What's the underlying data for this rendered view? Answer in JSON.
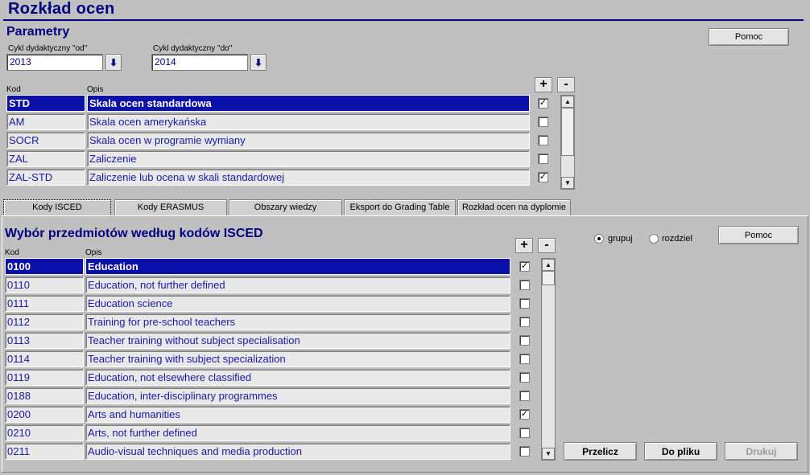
{
  "window": {
    "title": "Rozkład  ocen"
  },
  "params": {
    "section_title": "Parametry",
    "from_label": "Cykl dydaktyczny \"od\"",
    "from_value": "2013",
    "to_label": "Cykl dydaktyczny \"do\"",
    "to_value": "2014",
    "help_label": "Pomoc",
    "col_code": "Kod",
    "col_desc": "Opis",
    "plus": "+",
    "minus": "-",
    "rows": [
      {
        "code": "STD",
        "desc": "Skala ocen standardowa",
        "checked": true,
        "selected": true
      },
      {
        "code": "AM",
        "desc": "Skala ocen amerykańska",
        "checked": false,
        "selected": false
      },
      {
        "code": "SOCR",
        "desc": "Skala ocen w programie wymiany",
        "checked": false,
        "selected": false
      },
      {
        "code": "ZAL",
        "desc": "Zaliczenie",
        "checked": false,
        "selected": false
      },
      {
        "code": "ZAL-STD",
        "desc": "Zaliczenie lub ocena w skali standardowej",
        "checked": true,
        "selected": false
      }
    ]
  },
  "tabs": [
    {
      "label": "Kody ISCED",
      "active": true
    },
    {
      "label": "Kody ERASMUS",
      "active": false
    },
    {
      "label": "Obszary wiedzy",
      "active": false
    },
    {
      "label": "Eksport do Grading Table",
      "active": false
    },
    {
      "label": "Rozkład ocen na dyplomie",
      "active": false
    }
  ],
  "isced": {
    "section_title": "Wybór przedmiotów według kodów ISCED",
    "col_code": "Kod",
    "col_desc": "Opis",
    "plus": "+",
    "minus": "-",
    "radio_group": "grupuj",
    "radio_split": "rozdziel",
    "help_label": "Pomoc",
    "recalc_label": "Przelicz",
    "tofile_label": "Do pliku",
    "print_label": "Drukuj",
    "rows": [
      {
        "code": "0100",
        "desc": "Education",
        "checked": true,
        "selected": true
      },
      {
        "code": "0110",
        "desc": "Education, not further defined",
        "checked": false,
        "selected": false
      },
      {
        "code": "0111",
        "desc": "Education science",
        "checked": false,
        "selected": false
      },
      {
        "code": "0112",
        "desc": "Training for pre-school teachers",
        "checked": false,
        "selected": false
      },
      {
        "code": "0113",
        "desc": "Teacher training without subject specialisation",
        "checked": false,
        "selected": false
      },
      {
        "code": "0114",
        "desc": "Teacher training with subject specialization",
        "checked": false,
        "selected": false
      },
      {
        "code": "0119",
        "desc": "Education, not elsewhere classified",
        "checked": false,
        "selected": false
      },
      {
        "code": "0188",
        "desc": "Education, inter-disciplinary programmes",
        "checked": false,
        "selected": false
      },
      {
        "code": "0200",
        "desc": "Arts and humanities",
        "checked": true,
        "selected": false
      },
      {
        "code": "0210",
        "desc": "Arts, not further defined",
        "checked": false,
        "selected": false
      },
      {
        "code": "0211",
        "desc": "Audio-visual techniques and media production",
        "checked": false,
        "selected": false
      }
    ]
  },
  "icons": {
    "download": "download-arrow-icon",
    "scroll_up": "scroll-up-icon",
    "scroll_down": "scroll-down-icon"
  }
}
